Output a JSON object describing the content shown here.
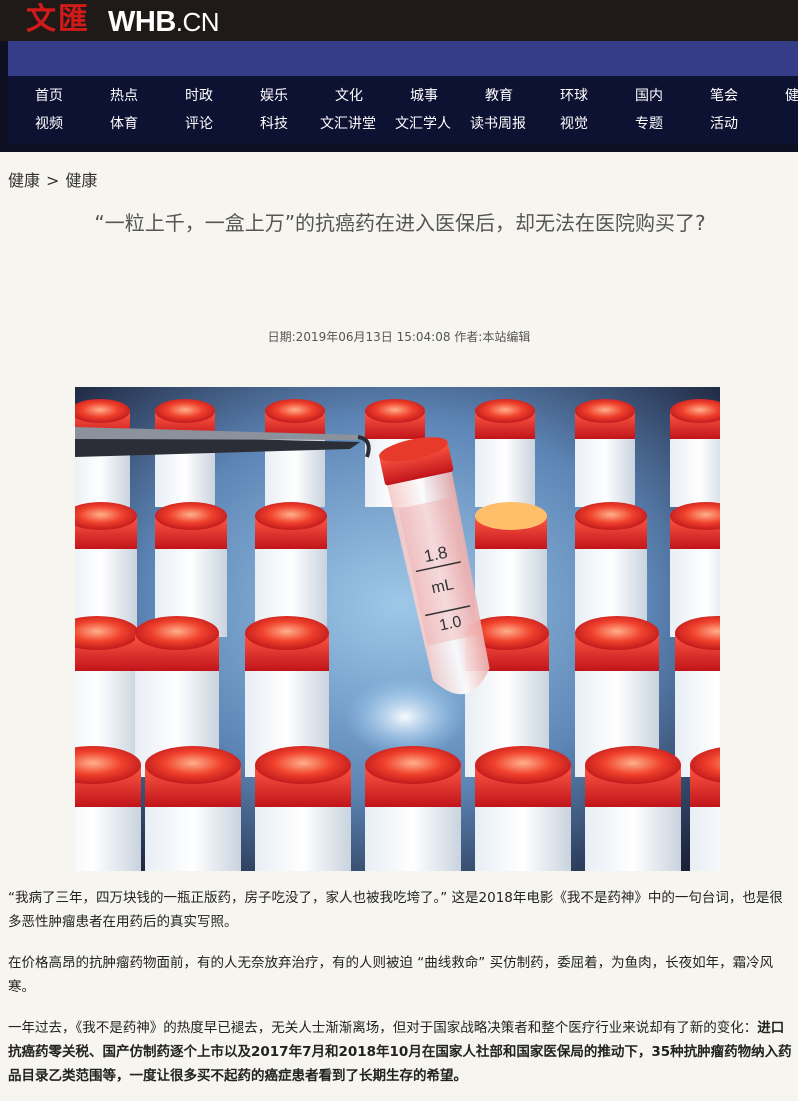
{
  "header": {
    "logo_cn": "文匯",
    "logo_en": "WHB",
    "logo_suffix": ".CN"
  },
  "nav": {
    "row1": [
      "首页",
      "热点",
      "时政",
      "娱乐",
      "文化",
      "城事",
      "教育",
      "环球",
      "国内",
      "笔会",
      "健"
    ],
    "row2": [
      "视频",
      "体育",
      "评论",
      "科技",
      "文汇讲堂",
      "文汇学人",
      "读书周报",
      "视觉",
      "专题",
      "活动"
    ]
  },
  "breadcrumb": {
    "first": "健康",
    "separator": ">",
    "second": "健康"
  },
  "article": {
    "title": "“一粒上千，一盒上万”的抗癌药在进入医保后，却无法在医院购买了?",
    "meta": "日期:2019年06月13日 15:04:08 作者:本站编辑",
    "image": {
      "tube_label_top": "1.8",
      "tube_label_unit": "mL",
      "tube_label_bottom": "1.0"
    },
    "p1": "“我病了三年，四万块钱的一瓶正版药，房子吃没了，家人也被我吃垮了。” 这是2018年电影《我不是药神》中的一句台词，也是很多恶性肿瘤患者在用药后的真实写照。",
    "p2": "在价格高昂的抗肿瘤药物面前，有的人无奈放弃治疗，有的人则被迫 “曲线救命” 买仿制药，委屈着，为鱼肉，长夜如年，霜冷风寒。",
    "p3_normal": "一年过去，《我不是药神》的热度早已褪去，无关人士渐渐离场，但对于国家战略决策者和整个医疗行业来说却有了新的变化：",
    "p3_bold": "进口抗癌药零关税、国产仿制药逐个上市以及2017年7月和2018年10月在国家人社部和国家医保局的推动下，35种抗肿瘤药物纳入药品目录乙类范围等，一度让很多买不起药的癌症患者看到了长期生存的希望。"
  },
  "colors": {
    "topbar": "#1f1a17",
    "bluebar": "#353d88",
    "nav_bg": "#0d1233",
    "logo_red": "#d11a1a",
    "page_bg": "#f7f5ef"
  }
}
